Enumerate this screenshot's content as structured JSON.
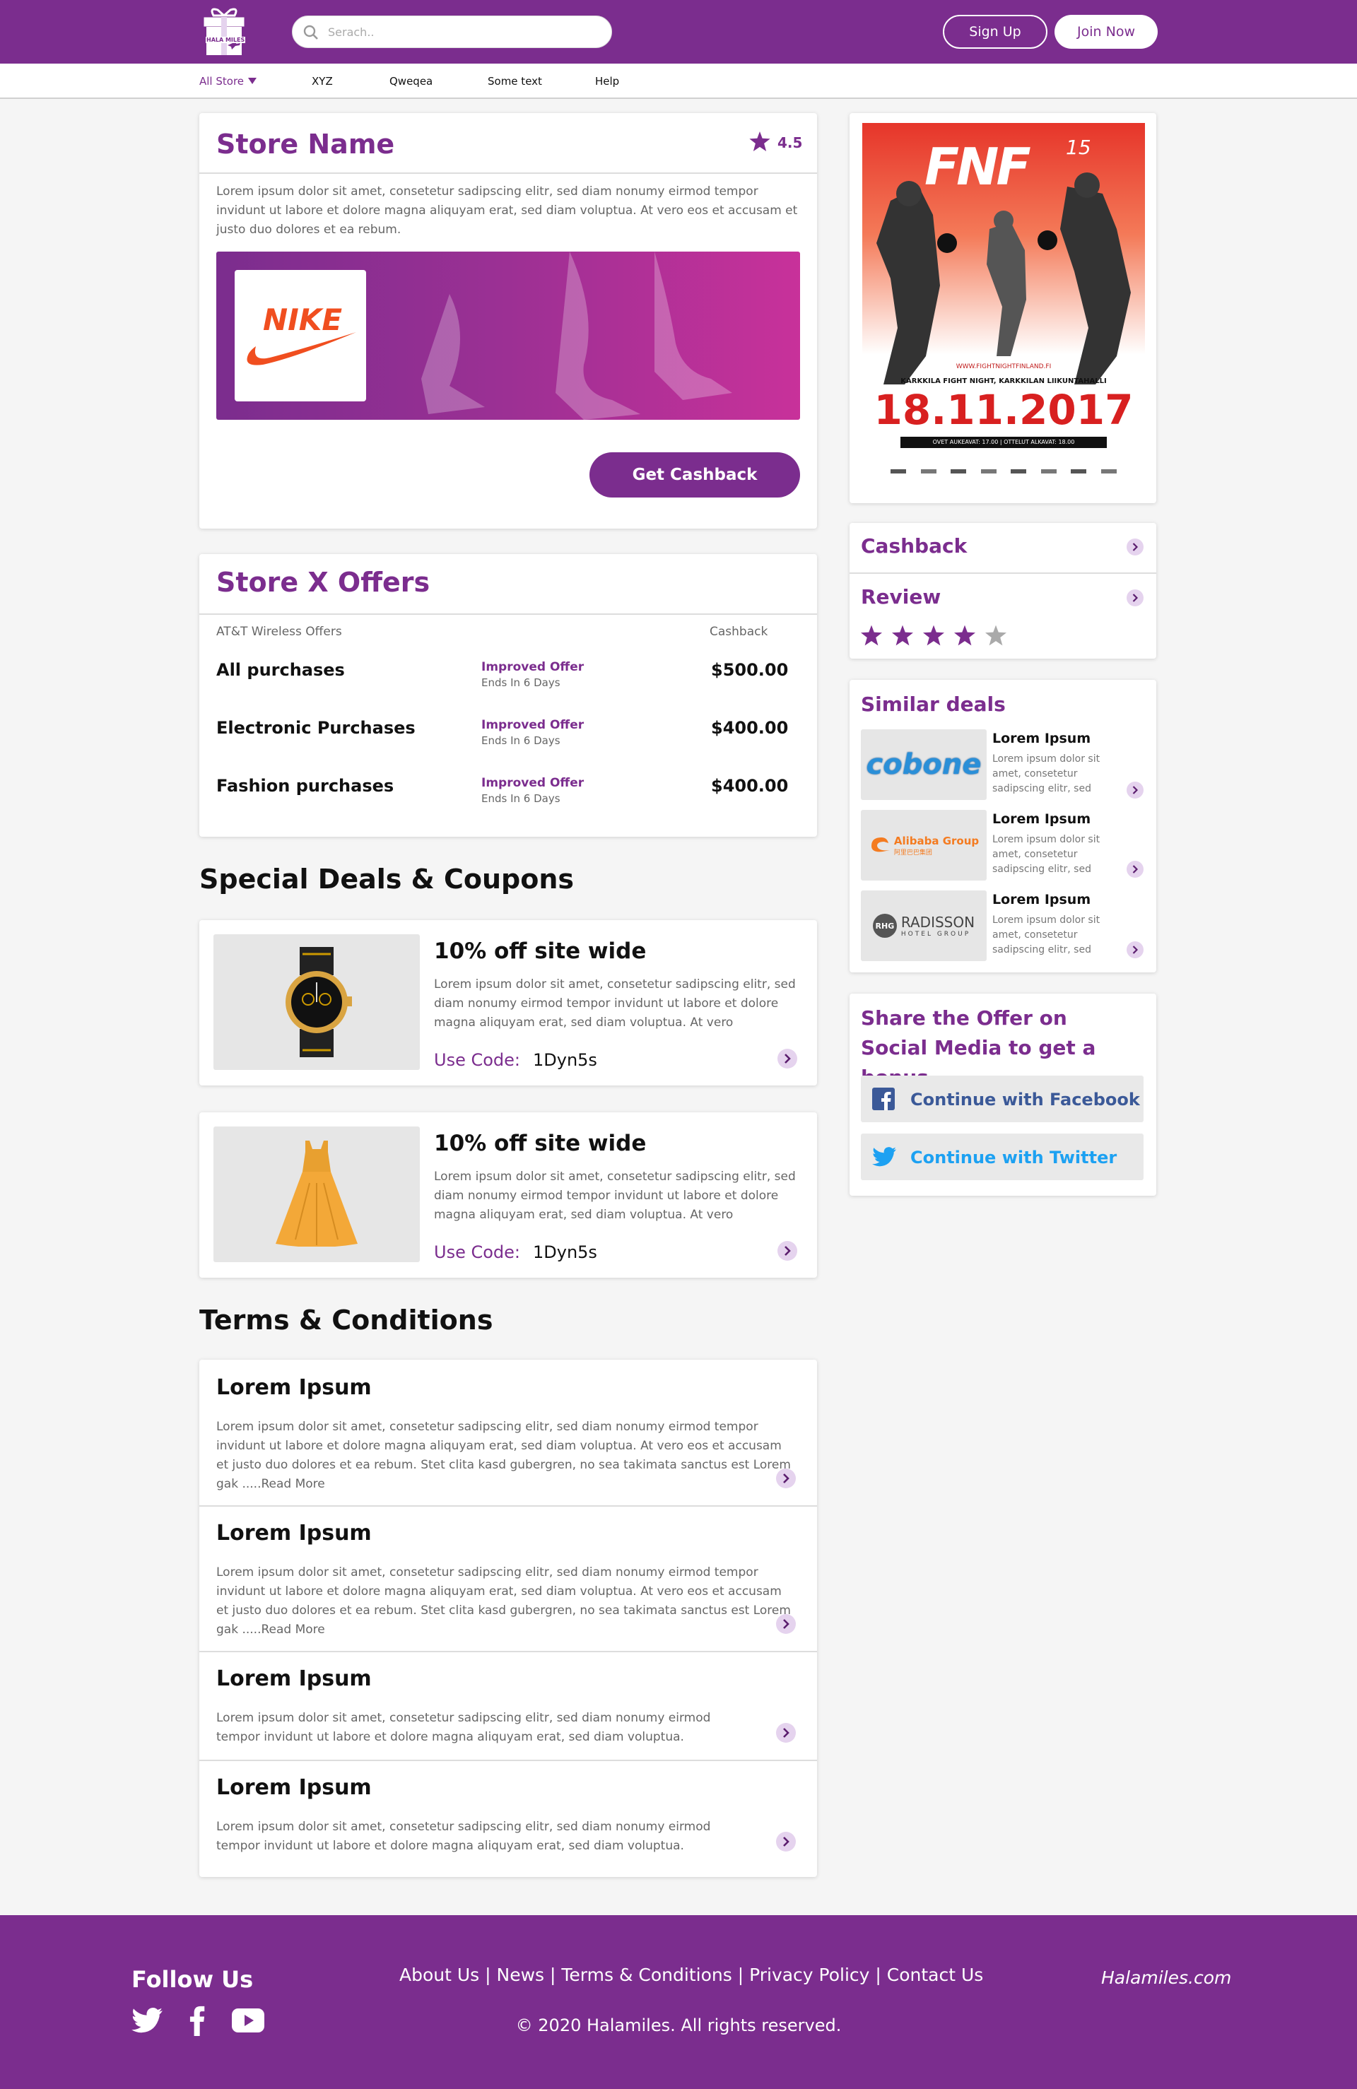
{
  "header": {
    "logo_text": "HALA MILES",
    "search_placeholder": "Serach..",
    "signup_label": "Sign Up",
    "join_label": "Join Now"
  },
  "nav": {
    "items": [
      "All Store",
      "XYZ",
      "Qweqea",
      "Some text",
      "Help"
    ]
  },
  "store": {
    "name": "Store Name",
    "rating": "4.5",
    "description": "Lorem ipsum dolor sit amet, consetetur sadipscing elitr, sed diam nonumy eirmod tempor invidunt ut labore et dolore magna aliquyam erat, sed diam voluptua. At vero eos et accusam et justo duo dolores et ea rebum.",
    "brand_logo": "NIKE",
    "cashback_button": "Get Cashback"
  },
  "offers": {
    "title": "Store X Offers",
    "col_left": "AT&T Wireless Offers",
    "col_right": "Cashback",
    "rows": [
      {
        "name": "All purchases",
        "tag": "Improved Offer",
        "ends": "Ends In 6 Days",
        "amount": "$500.00"
      },
      {
        "name": "Electronic Purchases",
        "tag": "Improved Offer",
        "ends": "Ends In 6 Days",
        "amount": "$400.00"
      },
      {
        "name": "Fashion purchases",
        "tag": "Improved Offer",
        "ends": "Ends In 6 Days",
        "amount": "$400.00"
      }
    ]
  },
  "deals": {
    "title": "Special Deals & Coupons",
    "items": [
      {
        "title": "10% off site wide",
        "description": "Lorem ipsum dolor sit amet, consetetur sadipscing elitr, sed diam nonumy eirmod tempor invidunt ut labore et dolore magna aliquyam erat, sed diam voluptua. At vero",
        "code_label": "Use Code:",
        "code": "1Dyn5s",
        "image_icon": "watch-icon"
      },
      {
        "title": "10% off site wide",
        "description": "Lorem ipsum dolor sit amet, consetetur sadipscing elitr, sed diam nonumy eirmod tempor invidunt ut labore et dolore magna aliquyam erat, sed diam voluptua. At vero",
        "code_label": "Use Code:",
        "code": "1Dyn5s",
        "image_icon": "dress-icon"
      }
    ]
  },
  "terms": {
    "title": "Terms & Conditions",
    "items": [
      {
        "title": "Lorem Ipsum",
        "text": "Lorem ipsum dolor sit amet, consetetur sadipscing elitr, sed diam nonumy eirmod tempor invidunt ut labore et dolore magna aliquyam erat, sed diam voluptua. At vero eos et accusam et justo duo dolores et ea rebum. Stet clita kasd gubergren, no sea takimata sanctus est Lorem gak .....Read More"
      },
      {
        "title": "Lorem Ipsum",
        "text": "Lorem ipsum dolor sit amet, consetetur sadipscing elitr, sed diam nonumy eirmod tempor invidunt ut labore et dolore magna aliquyam erat, sed diam voluptua. At vero eos et accusam et justo duo dolores et ea rebum. Stet clita kasd gubergren, no sea takimata sanctus est Lorem gak .....Read More"
      },
      {
        "title": "Lorem Ipsum",
        "text": "Lorem ipsum dolor sit amet, consetetur sadipscing elitr, sed diam nonumy eirmod tempor invidunt ut labore et dolore magna aliquyam erat, sed diam voluptua."
      },
      {
        "title": "Lorem Ipsum",
        "text": "Lorem ipsum dolor sit amet, consetetur sadipscing elitr, sed diam nonumy eirmod tempor invidunt ut labore et dolore magna aliquyam erat, sed diam voluptua."
      }
    ]
  },
  "poster": {
    "logo": "FNF",
    "edition": "15",
    "url": "WWW.FIGHTNIGHTFINLAND.FI",
    "venue": "KARKKILA FIGHT NIGHT, KARKKILAN LIIKUNTAHALLI",
    "date": "18.11.2017",
    "doors": "OVET AUKEAVAT: 17.00 | OTTELUT ALKAVAT: 18.00"
  },
  "sidebar": {
    "cashback_label": "Cashback",
    "review_label": "Review",
    "review_stars": 4,
    "review_max": 5
  },
  "similar": {
    "title": "Similar deals",
    "items": [
      {
        "logo": "cobone",
        "title": "Lorem Ipsum",
        "text": "Lorem ipsum dolor sit amet, consetetur sadipscing elitr, sed"
      },
      {
        "logo": "Alibaba Group",
        "logo_sub": "阿里巴巴集团",
        "title": "Lorem Ipsum",
        "text": "Lorem ipsum dolor sit amet, consetetur sadipscing elitr, sed"
      },
      {
        "logo": "RADISSON",
        "logo_badge": "RHG",
        "logo_sub": "HOTEL GROUP",
        "title": "Lorem Ipsum",
        "text": "Lorem ipsum dolor sit amet, consetetur sadipscing elitr, sed"
      }
    ]
  },
  "share": {
    "title": "Share the Offer on Social Media to get a bonus",
    "facebook_label": "Continue with Facebook",
    "twitter_label": "Continue with Twitter"
  },
  "footer": {
    "follow_title": "Follow Us",
    "links": [
      "About Us",
      "News",
      "Terms & Conditions",
      "Privacy Policy",
      "Contact Us"
    ],
    "separator": " | ",
    "brand": "Halamiles.com",
    "copyright": "© 2020 Halamiles. All rights reserved."
  },
  "colors": {
    "brand_purple": "#7b2d8e",
    "facebook_blue": "#3b5998",
    "twitter_blue": "#1da1f2"
  }
}
